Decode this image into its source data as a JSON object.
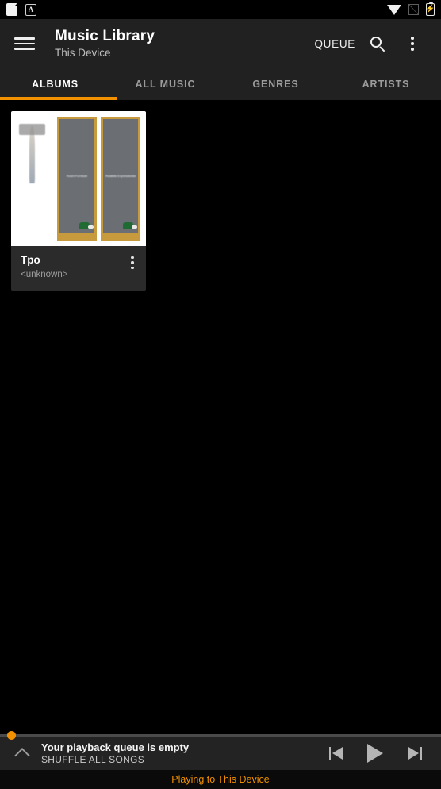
{
  "status_bar": {
    "left_icons": [
      {
        "name": "note-icon",
        "label": "note"
      },
      {
        "name": "a-letter-icon",
        "label": "A"
      }
    ],
    "right_icons": [
      {
        "name": "wifi-icon",
        "label": "wifi"
      },
      {
        "name": "no-signal-icon",
        "label": "no-signal"
      },
      {
        "name": "battery-charging-icon",
        "label": "charging"
      }
    ],
    "battery_glyph": "⚡"
  },
  "appbar": {
    "menu_icon": "hamburger-menu-icon",
    "title": "Music Library",
    "subtitle": "This Device",
    "queue_label": "QUEUE",
    "search_icon": "search-icon",
    "overflow_icon": "more-vert-icon"
  },
  "tabs": {
    "items": [
      {
        "label": "ALBUMS",
        "active": true
      },
      {
        "label": "ALL MUSIC",
        "active": false
      },
      {
        "label": "GENRES",
        "active": false
      },
      {
        "label": "ARTISTS",
        "active": false
      }
    ],
    "indicator_color": "#f29100"
  },
  "albums": [
    {
      "title": "Tpo",
      "artist": "<unknown>",
      "overflow_icon": "more-vert-icon",
      "artwork": {
        "panes": [
          {
            "type": "photo",
            "caption": ""
          },
          {
            "type": "poster",
            "caption": "Room Furniture"
          },
          {
            "type": "poster",
            "caption": "Realistic Expressionist"
          }
        ]
      }
    }
  ],
  "player": {
    "expand_icon": "chevron-up-icon",
    "title": "Your playback queue is empty",
    "subtitle": "SHUFFLE ALL SONGS",
    "seek_position_percent": 2,
    "controls": [
      {
        "name": "previous-button",
        "icon": "skip-previous-icon"
      },
      {
        "name": "play-button",
        "icon": "play-icon"
      },
      {
        "name": "next-button",
        "icon": "skip-next-icon"
      }
    ],
    "accent_color": "#f29100"
  },
  "footer": {
    "text": "Playing to This Device",
    "color": "#f29100"
  }
}
